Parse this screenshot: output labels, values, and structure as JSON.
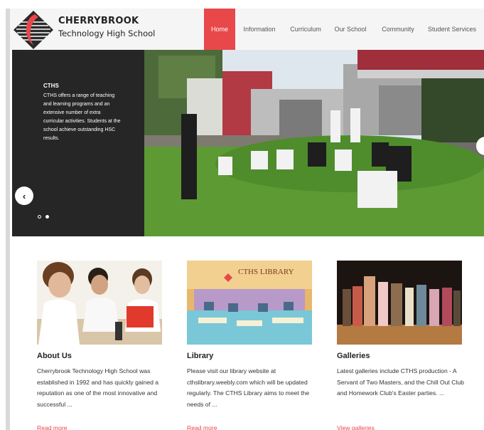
{
  "brand": {
    "name": "CHERRYBROOK",
    "subtitle": "Technology High School"
  },
  "nav": {
    "items": [
      {
        "label": "Home",
        "active": true
      },
      {
        "label": "Information",
        "active": false
      },
      {
        "label": "Curriculum",
        "active": false
      },
      {
        "label": "Our School",
        "active": false
      },
      {
        "label": "Community",
        "active": false
      },
      {
        "label": "Student Services",
        "active": false
      }
    ]
  },
  "hero": {
    "title": "CTHS",
    "text": "CTHS offers a range of teaching and learning programs and an extensive number of extra curricular activities. Students at the school achieve outstanding HSC results.",
    "slide_count": 2,
    "active_slide": 2,
    "prev_icon": "chevron-left-icon",
    "next_icon": "chevron-right-icon"
  },
  "cards": [
    {
      "title": "About Us",
      "text": "Cherrybrook Technology High School was established in 1992 and has quickly gained a reputation as one of the most innovative and successful ...",
      "link": "Read more"
    },
    {
      "title": "Library",
      "image_caption": "CTHS LIBRARY",
      "text": "Please visit our library website at cthslibrary.weebly.com which will be updated regularly. The CTHS Library aims to meet the needs of ...",
      "link": "Read more"
    },
    {
      "title": "Galleries",
      "text": "Latest galleries include CTHS production - A Servant of Two Masters, and the Chill Out Club and Homework Club's Easter parties. ...",
      "link": "View galleries"
    }
  ],
  "colors": {
    "accent": "#e8484a",
    "panel": "#262626",
    "header_bg": "#f5f5f5"
  }
}
